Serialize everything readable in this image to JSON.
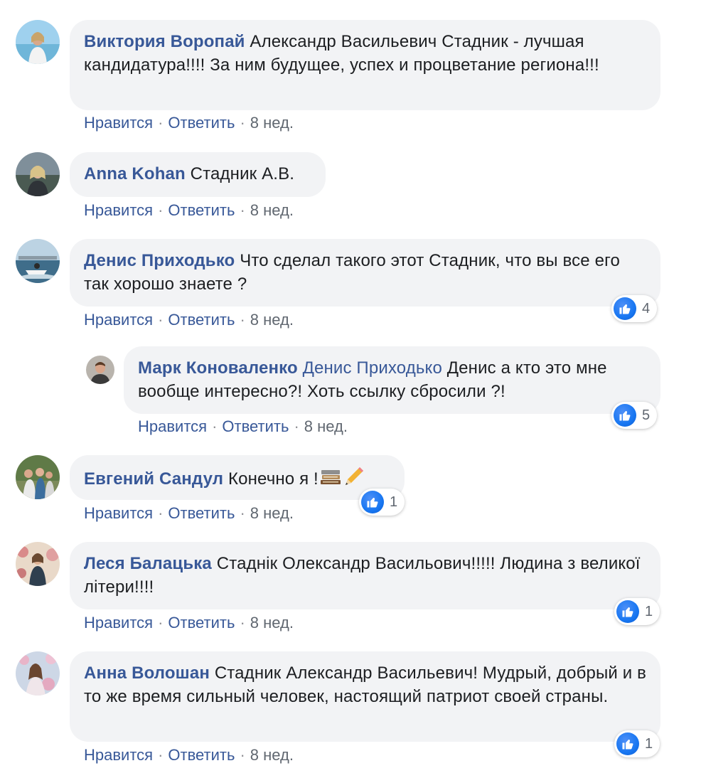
{
  "actions": {
    "like": "Нравится",
    "reply": "Ответить",
    "separator": "·"
  },
  "comments": [
    {
      "author": "Виктория Воропай",
      "text": "Александр Васильевич Стадник - лучшая кандидатура!!!! За ним будущее, успех и процветание региона!!!",
      "time": "8 нед."
    },
    {
      "author": "Anna Kohan",
      "text": "Стадник А.В.",
      "time": "8 нед."
    },
    {
      "author": "Денис Приходько",
      "text": "Что сделал такого этот Стадник, что вы все его так хорошо знаете ?",
      "time": "8 нед.",
      "reactions": "4"
    },
    {
      "author": "Марк Коноваленко",
      "mention": "Денис Приходько",
      "text": "Денис а кто это мне вообще интересно?! Хоть ссылку сбросили ?!",
      "time": "8 нед.",
      "reactions": "5"
    },
    {
      "author": "Евгений Сандул",
      "text": "Конечно я !",
      "emojis": [
        "books-icon",
        "pencil-icon"
      ],
      "time": "8 нед.",
      "reactions": "1"
    },
    {
      "author": "Леся Балацька",
      "text": "Стаднік Олександр Васильович!!!!! Людина з великої літери!!!!",
      "time": "8 нед.",
      "reactions": "1"
    },
    {
      "author": "Анна Волошан",
      "text": "Стадник Александр Васильевич! Мудрый, добрый и в то же время сильный человек, настоящий патриот своей страны.",
      "time": "8 нед.",
      "reactions": "1"
    }
  ],
  "colors": {
    "author": "#385898",
    "bubble": "#f2f3f5",
    "like": "#1877f2",
    "meta": "#606770"
  }
}
